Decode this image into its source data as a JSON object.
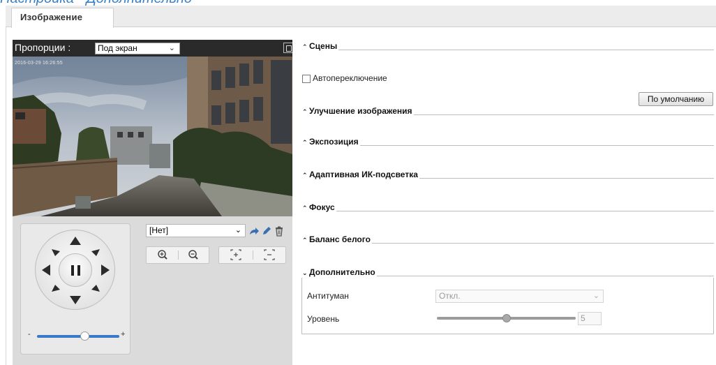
{
  "page": {
    "header_title": "Настройка - Дополнительно"
  },
  "tabs": [
    {
      "label": "Изображение",
      "active": true
    }
  ],
  "video": {
    "aspect_label": "Пропорции :",
    "aspect_select_value": "Под экран",
    "osd_timestamp": "2016-03-29 16:26:55"
  },
  "ptz": {
    "preset_select_value": "[Нет]",
    "speed_level": 0.58,
    "speed_minus": "-",
    "speed_plus": "+"
  },
  "settings": {
    "sections": [
      {
        "label": "Сцены",
        "expanded": false
      },
      {
        "label": "Улучшение изображения",
        "expanded": false
      },
      {
        "label": "Экспозиция",
        "expanded": false
      },
      {
        "label": "Адаптивная ИК-подсветка",
        "expanded": false
      },
      {
        "label": "Фокус",
        "expanded": false
      },
      {
        "label": "Баланс белого",
        "expanded": false
      },
      {
        "label": "Дополнительно",
        "expanded": true
      }
    ],
    "auto_switch_label": "Автопереключение",
    "auto_switch_checked": false,
    "default_button_label": "По умолчанию",
    "advanced": {
      "defog_label": "Антитуман",
      "defog_value": "Откл.",
      "level_label": "Уровень",
      "level_value": "5",
      "level_fraction": 0.5
    }
  },
  "colors": {
    "accent": "#3a78c8",
    "header_text": "#3b82c4"
  }
}
